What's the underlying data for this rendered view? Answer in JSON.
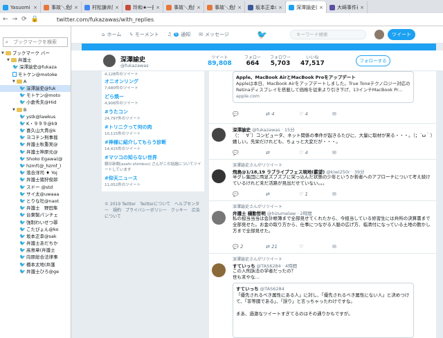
{
  "tabs": [
    {
      "title": "Yasuomi Sa",
      "color": "#1da1f2"
    },
    {
      "title": "事故＼危険",
      "color": "#e8763a"
    },
    {
      "title": "村松謙弁護",
      "color": "#4285f4"
    },
    {
      "title": "玲和★一部",
      "color": "#c94a3a"
    },
    {
      "title": "事故＼危険",
      "color": "#e8763a"
    },
    {
      "title": "事故＼危険",
      "color": "#e8763a"
    },
    {
      "title": "坂本正幸の",
      "color": "#3b5998"
    },
    {
      "title": "深澤諭史(",
      "color": "#1da1f2"
    },
    {
      "title": "大崎事件再",
      "color": "#5a4fa0"
    }
  ],
  "address": {
    "url": "twitter.com/fukazawas/with_replies"
  },
  "sidebar": {
    "search_placeholder": "ブックマークを検索",
    "items": [
      "ブックマーク バー",
      "弁護士",
      "深澤諭史@fukaza",
      "モトケン@motoke",
      "A",
      "深澤諭史@fuk",
      "モトケン@moto",
      "小倉秀夫@Hid",
      "B",
      "ystk@lawkus",
      "K・９９９@k9",
      "喜久山大貴@k",
      "ヨコチン刑事裁",
      "弁護士秋重実@",
      "弁護士神原元@",
      "Shoko Egawa(@",
      "hzmf(@_hzmf_)",
      "落合洋司 ♦ Yoj",
      "弁護士猪狩俊郎",
      "スドー @std",
      "サイ太@uwaaa",
      "とりな社@naot",
      "弁護士　野田隼",
      "台東製パンチェ",
      "強制わいせつ罪",
      "こたぴょん@ko",
      "坂本正幸@sak",
      "弁護士あだちか",
      "高島章(弁護士",
      "向原総合法律事",
      "橋本太地(弁護",
      "弁護士ひろ@ge"
    ]
  },
  "twitter_nav": {
    "home": "ホーム",
    "moments": "モーメント",
    "notifications": "通知",
    "notif_count": "5",
    "messages": "メッセージ",
    "search_placeholder": "キーワード検索",
    "tweet_button": "ツイート"
  },
  "profile": {
    "name": "深澤諭史",
    "handle": "@fukazawas",
    "stats": [
      {
        "label": "ツイート",
        "value": "89,808"
      },
      {
        "label": "フォロー",
        "value": "664"
      },
      {
        "label": "フォロワー",
        "value": "5,703"
      },
      {
        "label": "いいね",
        "value": "47,517"
      }
    ],
    "follow_button": "フォローする"
  },
  "trends": [
    {
      "name": "",
      "count": "4,128件のツイート"
    },
    {
      "name": "オニオンリング",
      "count": "7,680件のツイート"
    },
    {
      "name": "どら焼ー",
      "count": "4,906件のツイート"
    },
    {
      "name": "#うたコン",
      "count": "24,797件のツイート"
    },
    {
      "name": "#トリニクって何の肉",
      "count": "10,115件のツイート"
    },
    {
      "name": "#神様に紹介してもらう診断",
      "count": "14,415件のツイート"
    },
    {
      "name": "#マツコの知らない世界",
      "count": "朝日新聞(asahi shimbun) さんがこの話題についてツイートしています"
    },
    {
      "name": "#仰天ニュース",
      "count": "11,052件のツイート"
    }
  ],
  "footer": "© 2019 Twitter　Twitterについて　ヘルプセンター　規約　プライバシーポリシー　クッキー　広告について",
  "tweets": [
    {
      "card_title": "Apple、MacBook AirとMacBook Proをアップデート",
      "card_body": "Appleは本日、MacBook Airをアップデートしました。True Toneテクノロジー対応のRetinaディスプレイを搭載して価格を従来より引き下げ、13インチMacBook Pr...",
      "card_domain": "apple.com",
      "reply": "",
      "retweet": "4",
      "like": "4"
    },
    {
      "context": "",
      "name": "深澤諭史",
      "handle": "@fukazawas · 15分",
      "text": "（：｀∀´）コンビュータ、ネット関係の事件が起きるたびに、大量に取材が来る・・・。（；´ω｀）嬉しい。先栄だけれども、ちょっと大変だが・・・。",
      "reply": "",
      "retweet": "",
      "like": "4"
    },
    {
      "context": "深澤諭史さんがリツイート",
      "name": "飛鳥@1/18,19 ラブライブフェス現地(霰望)",
      "handle": "@kiwi250r · 39分",
      "text": "半グレ集団に両足ズブズブに突っ込んだ状態の少年というか若者へのアプローチについて考え続けているけれど未だ活路が見出だせていない。。。",
      "reply": "",
      "retweet": "",
      "like": "1"
    },
    {
      "context": "深澤諭史さんがリツイート",
      "name": "弁護士 樋勤哲明",
      "handle": "@hizumelaw · 2時間",
      "text": "私の担当当当は会計帳簿まで全部見せてくれたから、今担当している修習生には弁所の決算書まで全部見せた。お金の取り方から、仕事につながる人脈の広げ方、临清付になっている土地の動かし方まで全部見せた。",
      "reply": "2",
      "retweet": "21",
      "like": ""
    },
    {
      "context": "深澤諭史さんがリツイート",
      "name": "すていっち",
      "handle": "@TAS6284 · 4時間",
      "text": "この入刑訴法の学者だったの？\n世も末やな…",
      "quote_name": "すていっち",
      "quote_handle": "@TAS6284",
      "quote_text": "「優先されるべき属性にある人」に対し、「優先されるべき属性にない人」と決めつけて、「非等國である」、「誤り」と言っちゃったわけですな。\n\nまあ、過激なツイートすぎてるのはその通りかもですが。"
    }
  ]
}
